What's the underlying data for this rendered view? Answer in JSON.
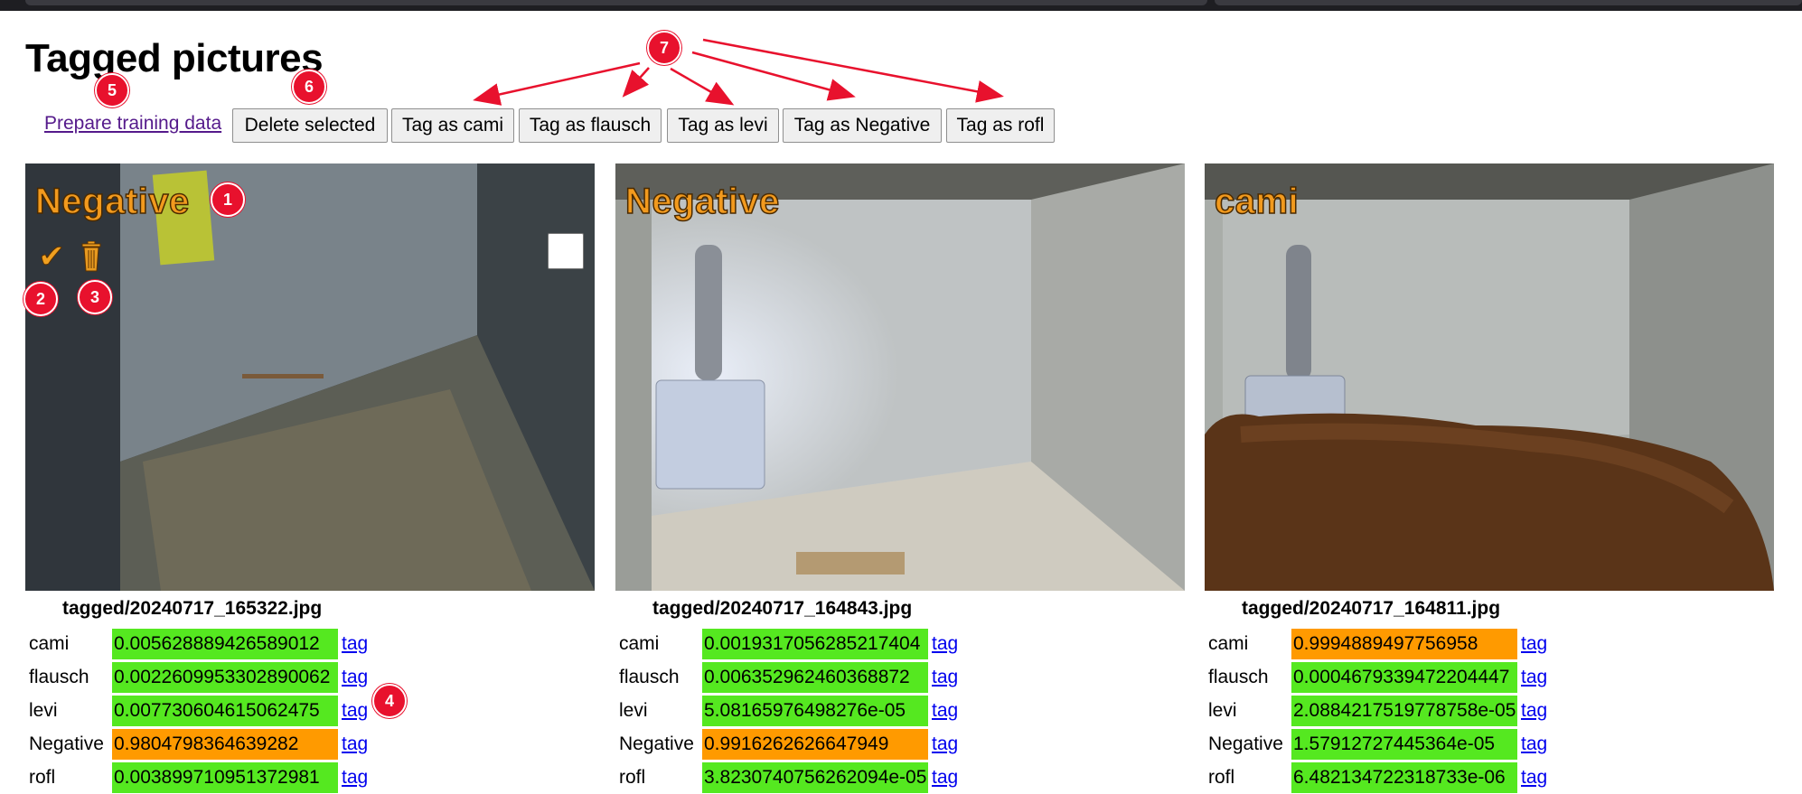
{
  "page": {
    "title": "Tagged pictures"
  },
  "toolbar": {
    "prepare_link": "Prepare training data",
    "buttons": [
      "Delete selected",
      "Tag as cami",
      "Tag as flausch",
      "Tag as levi",
      "Tag as Negative",
      "Tag as rofl"
    ]
  },
  "overlay_icons": {
    "check": "✔",
    "trash": "trash-icon"
  },
  "markers": [
    "1",
    "2",
    "3",
    "4",
    "5",
    "6",
    "7"
  ],
  "colors": {
    "low_score": "#55e820",
    "high_score": "#ff9a00",
    "label_text": "#f29a1e",
    "annotation": "#e8112d"
  },
  "tag_link": "tag",
  "cards": [
    {
      "label": "Negative",
      "filename": "tagged/20240717_165322.jpg",
      "scores": [
        {
          "name": "cami",
          "value": "0.005628889426589012"
        },
        {
          "name": "flausch",
          "value": "0.0022609953302890062"
        },
        {
          "name": "levi",
          "value": "0.007730604615062475"
        },
        {
          "name": "Negative",
          "value": "0.9804798364639282"
        },
        {
          "name": "rofl",
          "value": "0.003899710951372981"
        }
      ]
    },
    {
      "label": "Negative",
      "filename": "tagged/20240717_164843.jpg",
      "scores": [
        {
          "name": "cami",
          "value": "0.0019317056285217404"
        },
        {
          "name": "flausch",
          "value": "0.006352962460368872"
        },
        {
          "name": "levi",
          "value": "5.08165976498276e-05"
        },
        {
          "name": "Negative",
          "value": "0.9916262626647949"
        },
        {
          "name": "rofl",
          "value": "3.8230740756262094e-05"
        }
      ]
    },
    {
      "label": "cami",
      "filename": "tagged/20240717_164811.jpg",
      "scores": [
        {
          "name": "cami",
          "value": "0.9994889497756958"
        },
        {
          "name": "flausch",
          "value": "0.0004679339472204447"
        },
        {
          "name": "levi",
          "value": "2.0884217519778758e-05"
        },
        {
          "name": "Negative",
          "value": "1.57912727445364e-05"
        },
        {
          "name": "rofl",
          "value": "6.482134722318733e-06"
        }
      ]
    }
  ]
}
